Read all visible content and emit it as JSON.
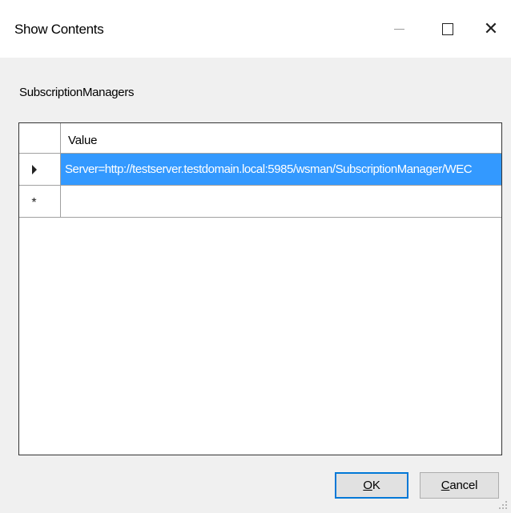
{
  "window": {
    "title": "Show Contents"
  },
  "section_label": "SubscriptionManagers",
  "grid": {
    "columns": [
      "Value"
    ],
    "rows": [
      {
        "value": "Server=http://testserver.testdomain.local:5985/wsman/SubscriptionManager/WEC",
        "selected": true
      },
      {
        "value": "",
        "new_row": true
      }
    ]
  },
  "buttons": {
    "ok_mnemonic": "O",
    "ok_rest": "K",
    "cancel_mnemonic": "C",
    "cancel_rest": "ancel"
  },
  "colors": {
    "selection": "#3399ff",
    "default_button_border": "#0078d7"
  },
  "icons": {
    "minimize": "minimize-icon",
    "maximize": "maximize-icon",
    "close": "close-icon",
    "current_row": "row-pointer-icon",
    "new_row": "new-row-asterisk-icon"
  }
}
